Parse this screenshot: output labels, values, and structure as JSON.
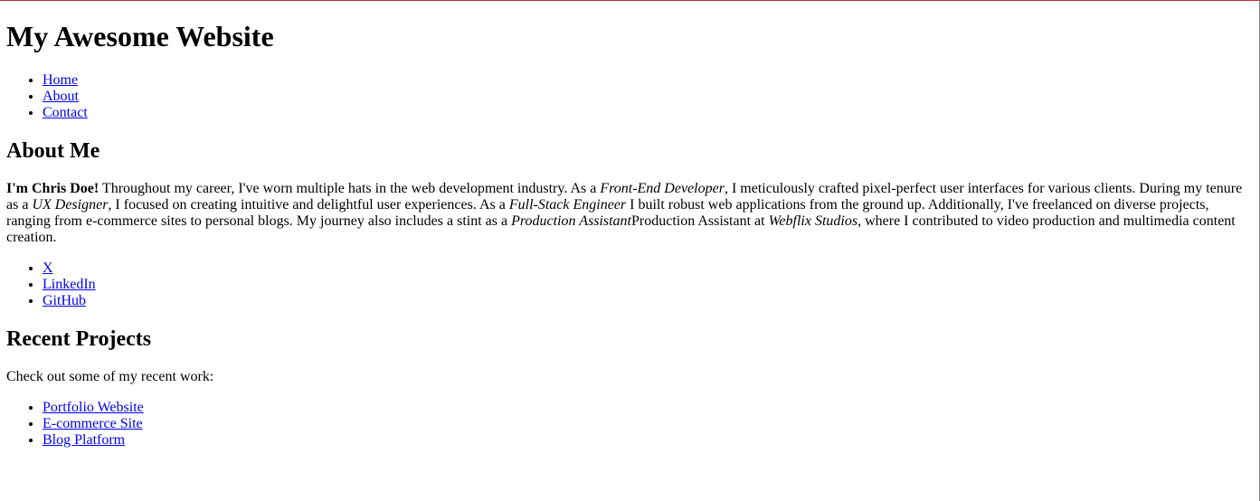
{
  "header": {
    "site_title": "My Awesome Website"
  },
  "nav": {
    "items": [
      {
        "label": "Home"
      },
      {
        "label": "About"
      },
      {
        "label": "Contact"
      }
    ]
  },
  "about": {
    "heading": "About Me",
    "bio": {
      "intro_bold": "I'm Chris Doe!",
      "t1": " Throughout my career, I've worn multiple hats in the web development industry. As a ",
      "role1": "Front-End Developer",
      "t2": ", I meticulously crafted pixel-perfect user interfaces for various clients. During my tenure as a ",
      "role2": "UX Designer",
      "t3": ", I focused on creating intuitive and delightful user experiences. As a ",
      "role3": "Full-Stack Engineer",
      "t4": " I built robust web applications from the ground up. Additionally, I've freelanced on diverse projects, ranging from e-commerce sites to personal blogs. My journey also includes a stint as a ",
      "role4": "Production Assistant",
      "t5": "Production Assistant at ",
      "company": "Webflix Studios",
      "t6": ", where I contributed to video production and multimedia content creation."
    },
    "social": [
      {
        "label": "X"
      },
      {
        "label": "LinkedIn"
      },
      {
        "label": "GitHub"
      }
    ]
  },
  "projects": {
    "heading": "Recent Projects",
    "intro": "Check out some of my recent work:",
    "items": [
      {
        "label": "Portfolio Website"
      },
      {
        "label": "E-commerce Site"
      },
      {
        "label": "Blog Platform"
      }
    ]
  }
}
